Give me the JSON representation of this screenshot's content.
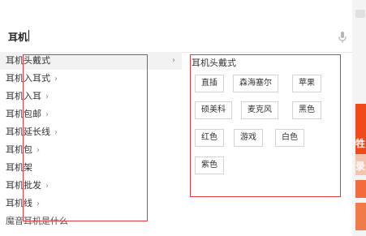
{
  "search": {
    "value": "耳机"
  },
  "suggestions": [
    {
      "label": "耳机头戴式",
      "chevron": "›"
    },
    {
      "label": "耳机入耳式",
      "chevron": "›"
    },
    {
      "label": "耳机入耳",
      "chevron": "›"
    },
    {
      "label": "耳机包邮",
      "chevron": "›"
    },
    {
      "label": "耳机延长线",
      "chevron": "›"
    },
    {
      "label": "耳机包",
      "chevron": "›"
    },
    {
      "label": "耳机架",
      "chevron": ""
    },
    {
      "label": "耳机批发",
      "chevron": "›"
    },
    {
      "label": "耳机线",
      "chevron": "›"
    },
    {
      "label": "魔音耳机是什么",
      "chevron": ""
    }
  ],
  "sub_panel": {
    "title": "耳机头戴式",
    "chips": [
      "直插",
      "森海塞尔",
      "苹果",
      "硕美科",
      "麦克风",
      "黑色",
      "红色",
      "游戏",
      "白色",
      "紫色"
    ]
  },
  "right_strip": {
    "glyph_1": "牲",
    "glyph_2": "录"
  },
  "colors": {
    "highlight": "#e0393e",
    "accent": "#f04a1a"
  }
}
